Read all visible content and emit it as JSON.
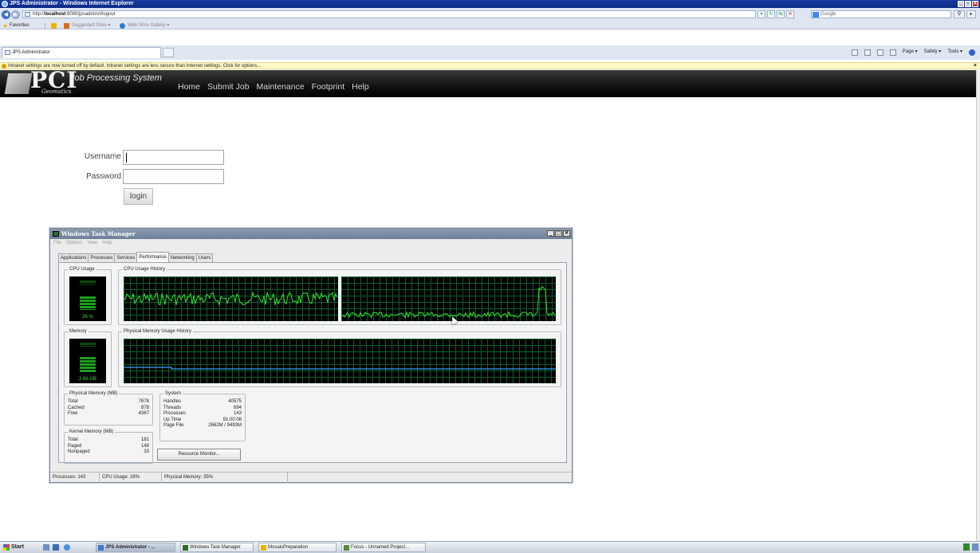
{
  "browser": {
    "title": "JPS Administrator - Windows Internet Explorer",
    "url_prefix": "http://",
    "url_host": "localhost",
    "url_rest": ":8080/jpsadmin/#logout",
    "search_placeholder": "Google",
    "favorites_label": "Favorites",
    "suggested_sites": "Suggested Sites ▾",
    "web_slice": "Web Slice Gallery ▾",
    "tab_label": "JPS Administrator",
    "cmd_page": "Page ▾",
    "cmd_safety": "Safety ▾",
    "cmd_tools": "Tools ▾",
    "infobar_text": "Intranet settings are now turned off by default. Intranet settings are less secure than Internet settings. Click for options..."
  },
  "site": {
    "logo_text": "PCI",
    "logo_sub": "Geomatics",
    "app_title": "Job Processing System",
    "nav": [
      "Home",
      "Submit Job",
      "Maintenance",
      "Footprint",
      "Help"
    ]
  },
  "login": {
    "username_label": "Username",
    "password_label": "Password",
    "button": "login"
  },
  "task_manager": {
    "title": "Windows Task Manager",
    "menu": [
      "File",
      "Options",
      "View",
      "Help"
    ],
    "tabs": [
      "Applications",
      "Processes",
      "Services",
      "Performance",
      "Networking",
      "Users"
    ],
    "active_tab": "Performance",
    "cpu_usage_label": "CPU Usage",
    "cpu_usage_value": "26 %",
    "cpu_usage_fraction": 0.26,
    "cpu_history_label": "CPU Usage History",
    "memory_label": "Memory",
    "memory_value": "2.66 GB",
    "memory_history_label": "Physical Memory Usage History",
    "physical_memory": {
      "label": "Physical Memory (MB)",
      "rows": [
        [
          "Total",
          "7678"
        ],
        [
          "Cached",
          "878"
        ],
        [
          "Free",
          "4367"
        ]
      ]
    },
    "kernel_memory": {
      "label": "Kernel Memory (MB)",
      "rows": [
        [
          "Total",
          "181"
        ],
        [
          "Paged",
          "148"
        ],
        [
          "Nonpaged",
          "33"
        ]
      ]
    },
    "system": {
      "label": "System",
      "rows": [
        [
          "Handles",
          "40575"
        ],
        [
          "Threads",
          "694"
        ],
        [
          "Processes",
          "143"
        ],
        [
          "Up Time",
          "91:00:08"
        ],
        [
          "Page File",
          "2662M / 9493M"
        ]
      ]
    },
    "resource_monitor_button": "Resource Monitor...",
    "status": {
      "processes": "Processes: 143",
      "cpu": "CPU Usage: 26%",
      "memory": "Physical Memory: 35%"
    }
  },
  "taskbar": {
    "start": "Start",
    "items": [
      {
        "label": "JPS Administrator - ...",
        "active": true,
        "icon_color": "#3a7bd5"
      },
      {
        "label": "Windows Task Manager",
        "active": false,
        "icon_color": "#2f6b2f"
      },
      {
        "label": "MosaicPreparation",
        "active": false,
        "icon_color": "#e0b800"
      },
      {
        "label": "Focus - Unnamed Project...",
        "active": false,
        "icon_color": "#5a8a3a"
      }
    ]
  },
  "colors": {
    "banner_bg": "#000000",
    "graph_line": "#2ee82e",
    "memory_line": "#3aa3ff",
    "infobar_bg": "#fff8c9"
  }
}
